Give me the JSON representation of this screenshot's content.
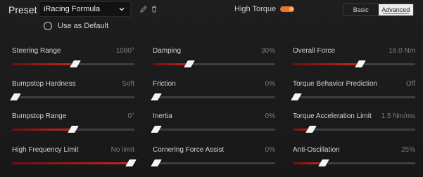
{
  "header": {
    "preset_label": "Preset",
    "preset_value": "iRacing Formula",
    "use_default_label": "Use as Default",
    "high_torque_label": "High Torque",
    "high_torque_on": true,
    "mode_basic": "Basic",
    "mode_advanced": "Advanced",
    "active_mode": "Advanced"
  },
  "colors": {
    "accent": "#e5621c",
    "slider_fill": "#c8281e",
    "track": "#3e3e3e"
  },
  "settings": [
    {
      "label": "Steering Range",
      "value": "1080°",
      "level": 0.52
    },
    {
      "label": "Damping",
      "value": "30%",
      "level": 0.3
    },
    {
      "label": "Overall Force",
      "value": "16.0 Nm",
      "level": 0.55
    },
    {
      "label": "Bumpstop Hardness",
      "value": "Soft",
      "level": 0.0
    },
    {
      "label": "Friction",
      "value": "0%",
      "level": 0.0
    },
    {
      "label": "Torque Behavior Prediction",
      "value": "Off",
      "level": 0.0
    },
    {
      "label": "Bumpstop Range",
      "value": "0°",
      "level": 0.5
    },
    {
      "label": "Inertia",
      "value": "0%",
      "level": 0.0
    },
    {
      "label": "Torque Acceleration Limit",
      "value": "1.5 Nm/ms",
      "level": 0.15
    },
    {
      "label": "High Frequency Limit",
      "value": "No limit",
      "level": 1.0
    },
    {
      "label": "Cornering Force Assist",
      "value": "0%",
      "level": 0.0
    },
    {
      "label": "Anti-Oscillation",
      "value": "25%",
      "level": 0.25
    }
  ]
}
